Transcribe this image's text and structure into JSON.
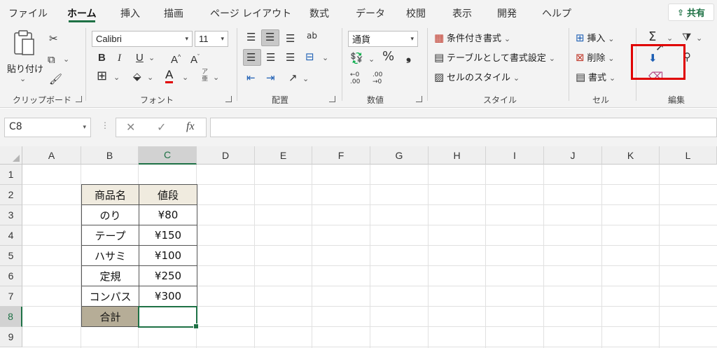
{
  "tabs": [
    {
      "label": "ファイル",
      "active": false
    },
    {
      "label": "ホーム",
      "active": true
    },
    {
      "label": "挿入",
      "active": false
    },
    {
      "label": "描画",
      "active": false
    },
    {
      "label": "ページ レイアウト",
      "active": false
    },
    {
      "label": "数式",
      "active": false
    },
    {
      "label": "データ",
      "active": false
    },
    {
      "label": "校閲",
      "active": false
    },
    {
      "label": "表示",
      "active": false
    },
    {
      "label": "開発",
      "active": false
    },
    {
      "label": "ヘルプ",
      "active": false
    }
  ],
  "share_label": "共有",
  "clipboard": {
    "paste_label": "貼り付け",
    "group_label": "クリップボード"
  },
  "font": {
    "name": "Calibri",
    "size": "11",
    "group_label": "フォント"
  },
  "alignment": {
    "group_label": "配置"
  },
  "number": {
    "format": "通貨",
    "group_label": "数値"
  },
  "styles": {
    "conditional": "条件付き書式",
    "as_table": "テーブルとして書式設定",
    "cell_styles": "セルのスタイル",
    "group_label": "スタイル"
  },
  "cells": {
    "insert": "挿入",
    "delete": "削除",
    "format": "書式",
    "group_label": "セル"
  },
  "editing": {
    "group_label": "編集"
  },
  "namebox": "C8",
  "accent_color": "#1e7145",
  "highlight_color": "#e00000",
  "columns": [
    "A",
    "B",
    "C",
    "D",
    "E",
    "F",
    "G",
    "H",
    "I",
    "J",
    "K",
    "L"
  ],
  "rows": [
    "1",
    "2",
    "3",
    "4",
    "5",
    "6",
    "7",
    "8",
    "9"
  ],
  "table": {
    "headers": [
      "商品名",
      "値段"
    ],
    "rows": [
      [
        "のり",
        "¥80"
      ],
      [
        "テープ",
        "¥150"
      ],
      [
        "ハサミ",
        "¥100"
      ],
      [
        "定規",
        "¥250"
      ],
      [
        "コンパス",
        "¥300"
      ]
    ],
    "total_label": "合計",
    "total_value": ""
  }
}
